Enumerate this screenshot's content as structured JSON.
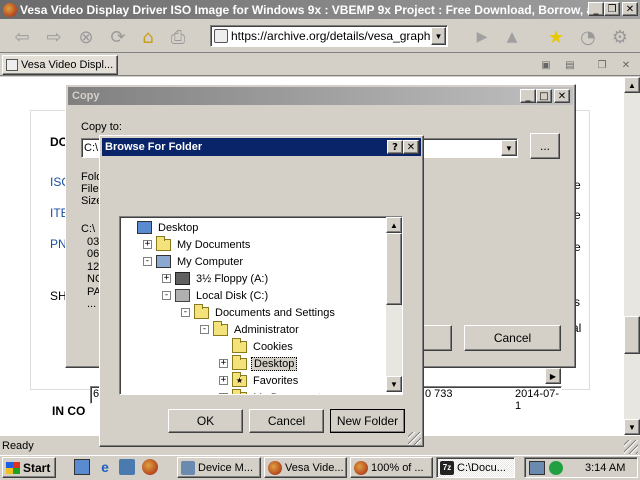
{
  "browser": {
    "title": "Vesa Video Display Driver ISO Image for Windows 9x : VBEMP 9x Project : Free Download, Borrow, a...",
    "url": "https://archive.org/details/vesa_graphics",
    "tab_label": "Vesa Video Displ...",
    "status": "Ready"
  },
  "page": {
    "heading1": "DO",
    "links": [
      "ISO",
      "ITE",
      "PN"
    ],
    "detail_lines": [
      "Fold",
      "File",
      "Size"
    ],
    "path_prefix": "C:\\",
    "list_lines": [
      "03",
      "06",
      "12",
      "NO",
      "PA"
    ],
    "sh_label": "SH",
    "ellipsis": "...",
    "right_fragments": [
      "e",
      "e",
      "e",
      "s",
      "al"
    ],
    "heading2": "IN CO",
    "row_size": "0 733",
    "row_date": "2014-07-1",
    "row_num": "6"
  },
  "copy_dialog": {
    "title": "Copy",
    "copy_to_label": "Copy to:",
    "dest_value": "C:\\",
    "browse_button": "...",
    "cancel_button": "Cancel"
  },
  "browse_dialog": {
    "title": "Browse For Folder",
    "tree": [
      {
        "label": "Desktop",
        "level": 0,
        "expander": "",
        "icon": "desktop"
      },
      {
        "label": "My Documents",
        "level": 1,
        "expander": "+",
        "icon": "documents"
      },
      {
        "label": "My Computer",
        "level": 1,
        "expander": "-",
        "icon": "computer"
      },
      {
        "label": "3½ Floppy (A:)",
        "level": 2,
        "expander": "+",
        "icon": "floppy"
      },
      {
        "label": "Local Disk (C:)",
        "level": 2,
        "expander": "-",
        "icon": "drive"
      },
      {
        "label": "Documents and Settings",
        "level": 3,
        "expander": "-",
        "icon": "folder"
      },
      {
        "label": "Administrator",
        "level": 4,
        "expander": "-",
        "icon": "folder"
      },
      {
        "label": "Cookies",
        "level": 5,
        "expander": "",
        "icon": "folder"
      },
      {
        "label": "Desktop",
        "level": 5,
        "expander": "+",
        "icon": "folder",
        "selected": true
      },
      {
        "label": "Favorites",
        "level": 5,
        "expander": "+",
        "icon": "folder-star"
      },
      {
        "label": "My Documents",
        "level": 5,
        "expander": "+",
        "icon": "folder"
      }
    ],
    "ok_button": "OK",
    "cancel_button": "Cancel",
    "new_folder_button": "New Folder"
  },
  "taskbar": {
    "start": "Start",
    "buttons": [
      "Device M...",
      "Vesa Vide...",
      "100% of ...",
      "C:\\Docu..."
    ],
    "time": "3:14 AM"
  },
  "colors": {
    "title_active": "#0a246a",
    "title_active_end": "#a6caf0",
    "selection": "#0a246a",
    "face": "#d4d0c8"
  }
}
